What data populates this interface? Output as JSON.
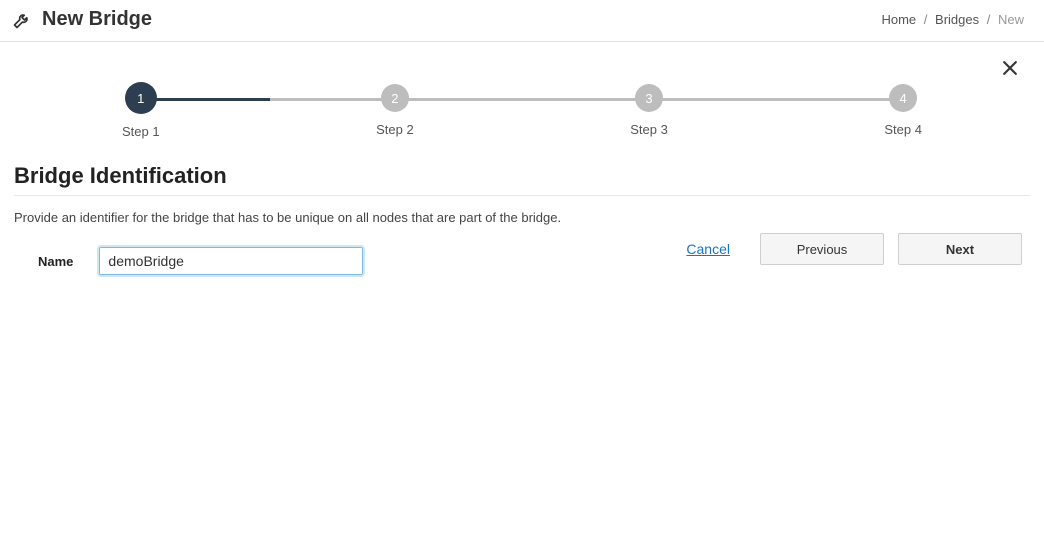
{
  "header": {
    "title": "New Bridge",
    "breadcrumb": {
      "home": "Home",
      "bridges": "Bridges",
      "current": "New"
    }
  },
  "stepper": {
    "steps": [
      {
        "num": "1",
        "label": "Step 1"
      },
      {
        "num": "2",
        "label": "Step 2"
      },
      {
        "num": "3",
        "label": "Step 3"
      },
      {
        "num": "4",
        "label": "Step 4"
      }
    ],
    "active_index": 0
  },
  "section": {
    "title": "Bridge Identification",
    "description": "Provide an identifier for the bridge that has to be unique on all nodes that are part of the bridge."
  },
  "form": {
    "name_label": "Name",
    "name_value": "demoBridge"
  },
  "footer": {
    "cancel": "Cancel",
    "previous": "Previous",
    "next": "Next"
  }
}
